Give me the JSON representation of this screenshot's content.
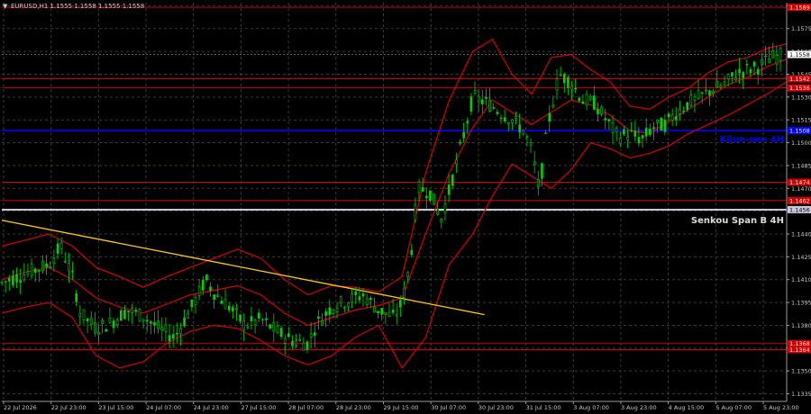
{
  "header": {
    "symbol_info": "EURUSD,H1  1.1555 1.1558 1.1555 1.1558"
  },
  "chart_data": {
    "type": "candlestick",
    "ylim": [
      1.133,
      1.1592
    ],
    "grid": true,
    "background": "#000000",
    "colors": {
      "candle": "#00d400",
      "bands": "#d40000",
      "level_lines": "#cc0000",
      "kijun": "#0000ff",
      "senkou": "#c8c8dc",
      "trendline": "#ffcc00",
      "grid": "#3a3a3a",
      "axis_text": "#c8c8c8"
    },
    "y_ticks": [
      "1.1335",
      "1.1350",
      "1.1365",
      "1.1380",
      "1.1395",
      "1.1410",
      "1.1425",
      "1.1440",
      "1.1455",
      "1.1470",
      "1.1485",
      "1.1500",
      "1.1515",
      "1.1530",
      "1.1545",
      "1.1560",
      "1.1575",
      "1.1590"
    ],
    "x_ticks": [
      "22 Jul 2026",
      "22 Jul 23:00",
      "23 Jul 15:00",
      "24 Jul 07:00",
      "24 Jul 23:00",
      "27 Jul 15:00",
      "28 Jul 07:00",
      "28 Jul 23:00",
      "29 Jul 15:00",
      "30 Jul 07:00",
      "30 Jul 23:00",
      "31 Jul 15:00",
      "3 Aug 07:00",
      "3 Aug 23:00",
      "4 Aug 15:00",
      "5 Aug 07:00",
      "5 Aug 23:00"
    ],
    "levels": [
      {
        "price": 1.1589,
        "label": "1.1589",
        "color": "#cc0000",
        "labelbg": "#cc0000"
      },
      {
        "price": 1.1542,
        "label": "1.1542",
        "color": "#cc0000",
        "labelbg": "#cc0000"
      },
      {
        "price": 1.1536,
        "label": "1.1536",
        "color": "#cc0000",
        "labelbg": "#cc0000"
      },
      {
        "price": 1.1508,
        "label": "1.1508",
        "color": "#0000ff",
        "labelbg": "#0000ff"
      },
      {
        "price": 1.1474,
        "label": "1.1474",
        "color": "#cc0000",
        "labelbg": "#cc0000"
      },
      {
        "price": 1.1462,
        "label": "1.1462",
        "color": "#cc0000",
        "labelbg": "#cc0000"
      },
      {
        "price": 1.1456,
        "label": "1.1456",
        "color": "#c8c8dc",
        "labelbg": "#c8c8dc"
      },
      {
        "price": 1.1368,
        "label": "1.1368",
        "color": "#cc0000",
        "labelbg": "#cc0000"
      },
      {
        "price": 1.1364,
        "label": "1.1364",
        "color": "#cc0000",
        "labelbg": "#cc0000"
      }
    ],
    "current_price": {
      "price": 1.1558,
      "label": "1.1558"
    },
    "annotations": [
      {
        "text": "Kijun-sen 4H",
        "price": 1.1502,
        "color": "#0000ff"
      },
      {
        "text": "Senkou Span B 4H",
        "price": 1.1449,
        "color": "#dcdcdc"
      }
    ],
    "trendline": {
      "start": [
        0,
        1.1449
      ],
      "end": [
        0.615,
        1.1387
      ]
    },
    "bands_upper": [
      [
        0,
        1.1432
      ],
      [
        0.03,
        1.1436
      ],
      [
        0.06,
        1.144
      ],
      [
        0.09,
        1.1432
      ],
      [
        0.12,
        1.1418
      ],
      [
        0.15,
        1.1412
      ],
      [
        0.18,
        1.1405
      ],
      [
        0.21,
        1.1412
      ],
      [
        0.24,
        1.1418
      ],
      [
        0.27,
        1.1424
      ],
      [
        0.3,
        1.143
      ],
      [
        0.33,
        1.1424
      ],
      [
        0.36,
        1.141
      ],
      [
        0.39,
        1.14
      ],
      [
        0.42,
        1.1406
      ],
      [
        0.45,
        1.1405
      ],
      [
        0.48,
        1.1402
      ],
      [
        0.51,
        1.1412
      ],
      [
        0.54,
        1.148
      ],
      [
        0.57,
        1.1528
      ],
      [
        0.6,
        1.156
      ],
      [
        0.625,
        1.1568
      ],
      [
        0.65,
        1.1545
      ],
      [
        0.675,
        1.1532
      ],
      [
        0.7,
        1.1556
      ],
      [
        0.725,
        1.1558
      ],
      [
        0.75,
        1.1548
      ],
      [
        0.775,
        1.154
      ],
      [
        0.8,
        1.1524
      ],
      [
        0.825,
        1.1522
      ],
      [
        0.85,
        1.153
      ],
      [
        0.875,
        1.1536
      ],
      [
        0.9,
        1.1546
      ],
      [
        0.925,
        1.1553
      ],
      [
        0.95,
        1.1556
      ],
      [
        0.975,
        1.1562
      ],
      [
        1.0,
        1.1565
      ]
    ],
    "bands_middle": [
      [
        0,
        1.141
      ],
      [
        0.03,
        1.1415
      ],
      [
        0.06,
        1.1418
      ],
      [
        0.09,
        1.141
      ],
      [
        0.12,
        1.1398
      ],
      [
        0.15,
        1.1392
      ],
      [
        0.18,
        1.1388
      ],
      [
        0.21,
        1.1394
      ],
      [
        0.24,
        1.14
      ],
      [
        0.27,
        1.1403
      ],
      [
        0.3,
        1.1406
      ],
      [
        0.33,
        1.14
      ],
      [
        0.36,
        1.1388
      ],
      [
        0.39,
        1.138
      ],
      [
        0.42,
        1.1385
      ],
      [
        0.45,
        1.139
      ],
      [
        0.48,
        1.1393
      ],
      [
        0.51,
        1.1398
      ],
      [
        0.54,
        1.144
      ],
      [
        0.57,
        1.148
      ],
      [
        0.6,
        1.151
      ],
      [
        0.625,
        1.1528
      ],
      [
        0.65,
        1.152
      ],
      [
        0.675,
        1.1512
      ],
      [
        0.7,
        1.152
      ],
      [
        0.725,
        1.1528
      ],
      [
        0.75,
        1.1525
      ],
      [
        0.775,
        1.1518
      ],
      [
        0.8,
        1.1508
      ],
      [
        0.825,
        1.1506
      ],
      [
        0.85,
        1.1514
      ],
      [
        0.875,
        1.1522
      ],
      [
        0.9,
        1.153
      ],
      [
        0.925,
        1.1538
      ],
      [
        0.95,
        1.1543
      ],
      [
        0.975,
        1.155
      ],
      [
        1.0,
        1.1555
      ]
    ],
    "bands_lower": [
      [
        0,
        1.1388
      ],
      [
        0.03,
        1.1392
      ],
      [
        0.06,
        1.1395
      ],
      [
        0.09,
        1.1385
      ],
      [
        0.12,
        1.136
      ],
      [
        0.15,
        1.1352
      ],
      [
        0.18,
        1.1356
      ],
      [
        0.21,
        1.1368
      ],
      [
        0.24,
        1.1376
      ],
      [
        0.27,
        1.138
      ],
      [
        0.3,
        1.1378
      ],
      [
        0.33,
        1.137
      ],
      [
        0.36,
        1.136
      ],
      [
        0.39,
        1.1354
      ],
      [
        0.42,
        1.136
      ],
      [
        0.45,
        1.1372
      ],
      [
        0.48,
        1.138
      ],
      [
        0.51,
        1.1352
      ],
      [
        0.54,
        1.1372
      ],
      [
        0.57,
        1.142
      ],
      [
        0.6,
        1.144
      ],
      [
        0.625,
        1.1465
      ],
      [
        0.65,
        1.1486
      ],
      [
        0.675,
        1.1478
      ],
      [
        0.7,
        1.147
      ],
      [
        0.725,
        1.1482
      ],
      [
        0.75,
        1.15
      ],
      [
        0.775,
        1.1496
      ],
      [
        0.8,
        1.149
      ],
      [
        0.825,
        1.1493
      ],
      [
        0.85,
        1.1498
      ],
      [
        0.875,
        1.1506
      ],
      [
        0.9,
        1.1512
      ],
      [
        0.925,
        1.1518
      ],
      [
        0.95,
        1.1525
      ],
      [
        0.975,
        1.1532
      ],
      [
        1.0,
        1.154
      ]
    ],
    "price_path": [
      [
        0,
        1.1408
      ],
      [
        0.02,
        1.1412
      ],
      [
        0.04,
        1.1416
      ],
      [
        0.06,
        1.142
      ],
      [
        0.075,
        1.1432
      ],
      [
        0.09,
        1.1412
      ],
      [
        0.1,
        1.1388
      ],
      [
        0.12,
        1.1378
      ],
      [
        0.14,
        1.1382
      ],
      [
        0.16,
        1.139
      ],
      [
        0.18,
        1.1386
      ],
      [
        0.2,
        1.1378
      ],
      [
        0.22,
        1.1372
      ],
      [
        0.24,
        1.139
      ],
      [
        0.26,
        1.141
      ],
      [
        0.27,
        1.1402
      ],
      [
        0.29,
        1.1392
      ],
      [
        0.31,
        1.138
      ],
      [
        0.33,
        1.1384
      ],
      [
        0.35,
        1.1376
      ],
      [
        0.37,
        1.137
      ],
      [
        0.39,
        1.1368
      ],
      [
        0.4,
        1.138
      ],
      [
        0.42,
        1.1392
      ],
      [
        0.44,
        1.1396
      ],
      [
        0.46,
        1.14
      ],
      [
        0.48,
        1.139
      ],
      [
        0.5,
        1.1385
      ],
      [
        0.51,
        1.1395
      ],
      [
        0.52,
        1.142
      ],
      [
        0.53,
        1.147
      ],
      [
        0.545,
        1.1468
      ],
      [
        0.56,
        1.145
      ],
      [
        0.575,
        1.1478
      ],
      [
        0.59,
        1.1508
      ],
      [
        0.6,
        1.153
      ],
      [
        0.62,
        1.1526
      ],
      [
        0.635,
        1.152
      ],
      [
        0.65,
        1.1515
      ],
      [
        0.665,
        1.1508
      ],
      [
        0.675,
        1.1495
      ],
      [
        0.685,
        1.1468
      ],
      [
        0.695,
        1.151
      ],
      [
        0.71,
        1.1545
      ],
      [
        0.725,
        1.154
      ],
      [
        0.74,
        1.1528
      ],
      [
        0.755,
        1.1526
      ],
      [
        0.77,
        1.1515
      ],
      [
        0.785,
        1.1504
      ],
      [
        0.8,
        1.1506
      ],
      [
        0.815,
        1.1502
      ],
      [
        0.83,
        1.151
      ],
      [
        0.845,
        1.1512
      ],
      [
        0.86,
        1.152
      ],
      [
        0.875,
        1.1526
      ],
      [
        0.89,
        1.153
      ],
      [
        0.905,
        1.1535
      ],
      [
        0.92,
        1.1538
      ],
      [
        0.935,
        1.1545
      ],
      [
        0.95,
        1.1548
      ],
      [
        0.965,
        1.155
      ],
      [
        0.98,
        1.1556
      ],
      [
        1.0,
        1.1558
      ]
    ]
  }
}
